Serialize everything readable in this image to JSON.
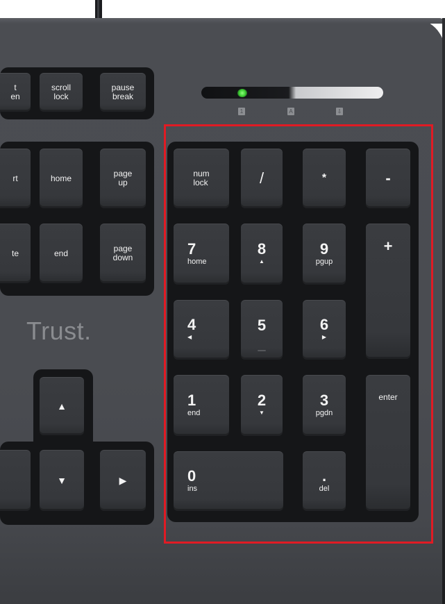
{
  "brand": {
    "logo_text": "Trust."
  },
  "lock_indicators": [
    "1",
    "A",
    "⇩"
  ],
  "nav_cluster": {
    "top_row": [
      "t\nen",
      "scroll\nlock",
      "pause\nbreak"
    ],
    "row2": [
      "rt",
      "home",
      "page\nup"
    ],
    "row3": [
      "te",
      "end",
      "page\ndown"
    ]
  },
  "arrows": {
    "up": "▲",
    "left": "",
    "down": "▼",
    "right": "▶"
  },
  "numpad": {
    "num_lock": "num\nlock",
    "divide": "/",
    "multiply": "*",
    "minus": "-",
    "plus": "+",
    "enter": "enter",
    "k7": {
      "main": "7",
      "sub": "home"
    },
    "k8": {
      "main": "8",
      "sub": "▲"
    },
    "k9": {
      "main": "9",
      "sub": "pgup"
    },
    "k4": {
      "main": "4",
      "sub": "◀"
    },
    "k5": {
      "main": "5",
      "sub": ""
    },
    "k6": {
      "main": "6",
      "sub": "▶"
    },
    "k1": {
      "main": "1",
      "sub": "end"
    },
    "k2": {
      "main": "2",
      "sub": "▼"
    },
    "k3": {
      "main": "3",
      "sub": "pgdn"
    },
    "k0": {
      "main": "0",
      "sub": "ins"
    },
    "kdot": {
      "main": ".",
      "sub": "del"
    }
  },
  "colors": {
    "highlight": "#e01b24",
    "led": "#3bcc32",
    "keyboard_body": "#4a4c51",
    "key": "#37393d"
  }
}
